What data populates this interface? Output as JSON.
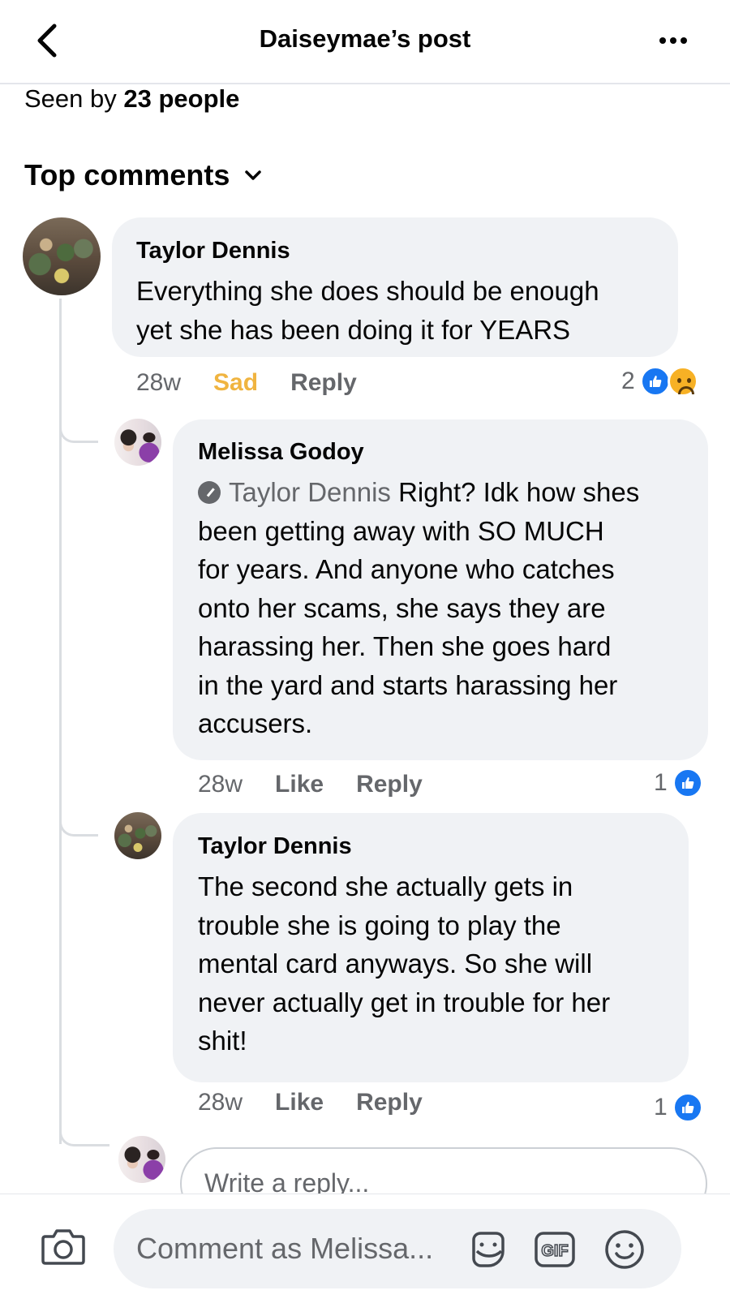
{
  "header": {
    "title": "Daiseymae’s post"
  },
  "seen": {
    "prefix": "Seen by",
    "count": "23 people"
  },
  "sort": {
    "label": "Top comments"
  },
  "comments": [
    {
      "author": "Taylor Dennis",
      "text_lines": [
        "Everything she does should be enough",
        "yet she has been doing it for YEARS"
      ],
      "time": "28w",
      "reaction_label": "Sad",
      "reply_label": "Reply",
      "reaction_count": "2"
    },
    {
      "author": "Melissa Godoy",
      "tagged": "Taylor Dennis",
      "first_line_rest": "Right? Idk how shes",
      "text_lines": [
        "been getting away with SO MUCH",
        "for years. And anyone who catches",
        "onto her scams, she says they are",
        "harassing her. Then she goes hard",
        "in the yard and starts harassing her",
        "accusers."
      ],
      "time": "28w",
      "like_label": "Like",
      "reply_label": "Reply",
      "reaction_count": "1"
    },
    {
      "author": "Taylor Dennis",
      "text_lines": [
        "The second she actually gets in",
        "trouble she is going to play the",
        "mental card anyways. So she will",
        "never actually get in trouble for her",
        "shit!"
      ],
      "time": "28w",
      "like_label": "Like",
      "reply_label": "Reply",
      "reaction_count": "1"
    }
  ],
  "reply_input": {
    "placeholder": "Write a reply..."
  },
  "composer": {
    "placeholder": "Comment as Melissa..."
  },
  "colors": {
    "like_blue": "#1877f2",
    "sad_yellow": "#f0b440",
    "bubble_gray": "#f0f2f5"
  }
}
